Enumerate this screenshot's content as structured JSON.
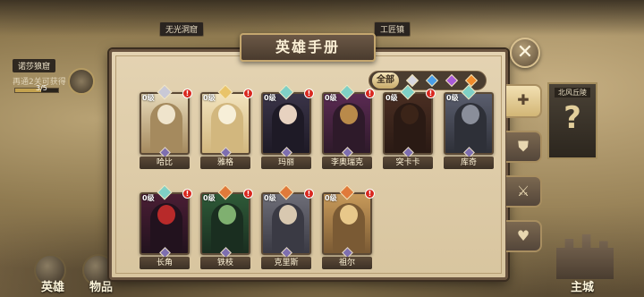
{
  "map": {
    "top_labels": [
      "无光洞窟",
      "工匠镇"
    ],
    "quest": {
      "title": "诺莎狼窟",
      "desc": "再通2关可获得",
      "progress_text": "3/5",
      "progress": 0.6
    },
    "right_label": "北风丘陵"
  },
  "nav": {
    "heroes": "英雄",
    "items": "物品",
    "main_city": "主城"
  },
  "panel": {
    "title": "英雄手册",
    "close_icon": "close-icon",
    "filter": {
      "all": "全部",
      "gems": [
        "#d6d6e0",
        "#4a9ee8",
        "#a85ad8",
        "#f08a2a"
      ]
    },
    "tabs": [
      "grid-icon",
      "shield-icon",
      "sword-icon",
      "heart-icon"
    ]
  },
  "heroes": [
    {
      "level": "0级",
      "name": "哈比",
      "rank": "#c9c9d6",
      "alert": "!",
      "colors": [
        "#e6d8b8",
        "#a58a5e",
        "#efe4cc"
      ]
    },
    {
      "level": "0级",
      "name": "雅格",
      "rank": "#e9c46a",
      "alert": "!",
      "colors": [
        "#f2e3bd",
        "#d2b77e",
        "#f7efd8"
      ]
    },
    {
      "level": "0级",
      "name": "玛丽",
      "rank": "#7fd0c6",
      "alert": "!",
      "colors": [
        "#3a3448",
        "#1e1a26",
        "#e7d2c0"
      ]
    },
    {
      "level": "0级",
      "name": "李奥瑞克",
      "rank": "#7fd0c6",
      "alert": "!",
      "colors": [
        "#5a2a52",
        "#2e1a2a",
        "#b98a4a"
      ]
    },
    {
      "level": "0级",
      "name": "突卡卡",
      "rank": "#7fd0c6",
      "alert": "!",
      "colors": [
        "#4a2e22",
        "#2a1a14",
        "#3b2418"
      ]
    },
    {
      "level": "0级",
      "name": "库奇",
      "rank": "#7fd0c6",
      "alert": "",
      "colors": [
        "#5a5e6e",
        "#2e3038",
        "#8a8e9a"
      ]
    },
    {
      "level": "0级",
      "name": "长角",
      "rank": "#7fd0c6",
      "alert": "!",
      "colors": [
        "#4a1e34",
        "#22121e",
        "#b82a2a"
      ]
    },
    {
      "level": "0级",
      "name": "铁枝",
      "rank": "#e07a3a",
      "alert": "!",
      "colors": [
        "#2e5a38",
        "#1a2e20",
        "#7fb070"
      ]
    },
    {
      "level": "0级",
      "name": "克里斯",
      "rank": "#e07a3a",
      "alert": "!",
      "colors": [
        "#6e6e78",
        "#3a3a44",
        "#d8c8b0"
      ]
    },
    {
      "level": "0级",
      "name": "祖尔",
      "rank": "#e07a3a",
      "alert": "!",
      "colors": [
        "#c89a5a",
        "#7a5a34",
        "#e8c88a"
      ]
    }
  ]
}
